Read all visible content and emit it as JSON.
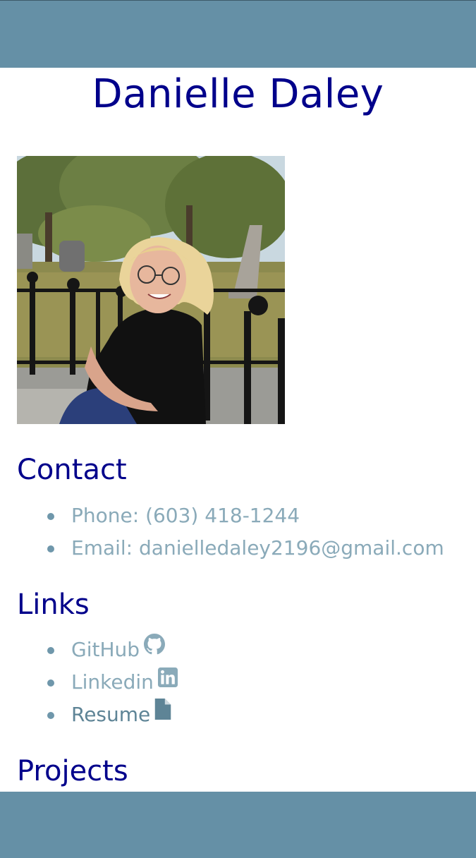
{
  "profile": {
    "name": "Danielle Daley",
    "photo_icon": "profile-photo"
  },
  "contact": {
    "heading": "Contact",
    "phone": "Phone: (603) 418-1244",
    "email": "Email: danielledaley2196@gmail.com"
  },
  "links": {
    "heading": "Links",
    "items": [
      {
        "label": "GitHub",
        "icon": "github-icon"
      },
      {
        "label": "Linkedin",
        "icon": "linkedin-icon"
      },
      {
        "label": "Resume",
        "icon": "file-icon"
      }
    ]
  },
  "projects": {
    "heading": "Projects"
  },
  "colors": {
    "header_bar": "#6590a6",
    "heading_text": "#00008b",
    "link_text": "#8aaab9",
    "bullet": "#6f97ab"
  }
}
